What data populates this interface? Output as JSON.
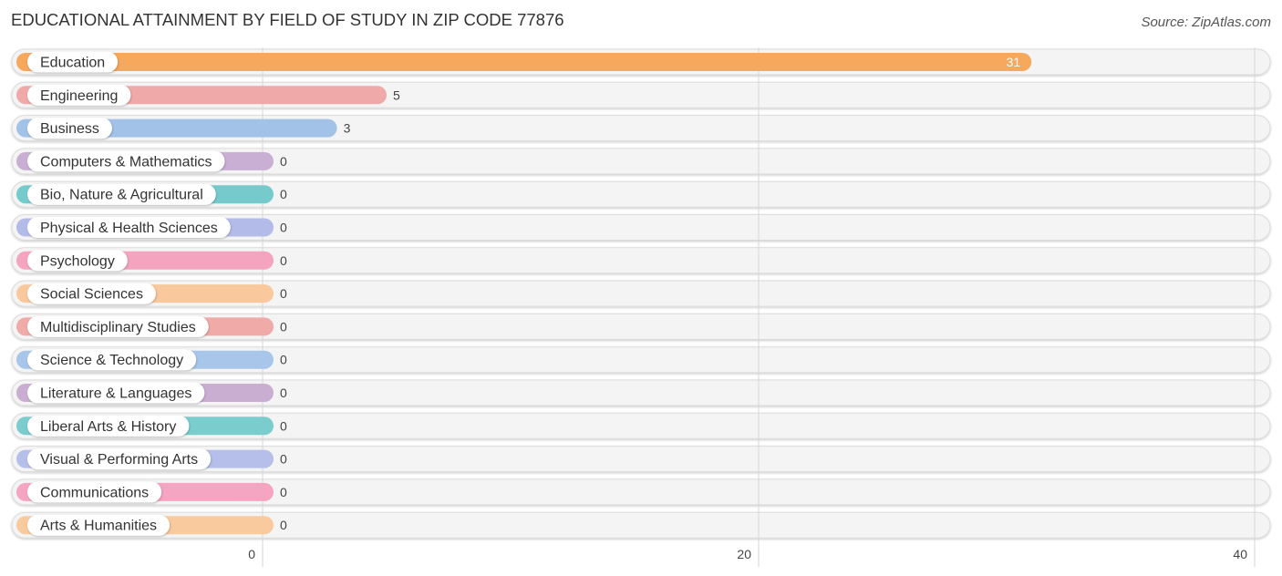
{
  "header": {
    "title": "EDUCATIONAL ATTAINMENT BY FIELD OF STUDY IN ZIP CODE 77876",
    "source": "Source: ZipAtlas.com"
  },
  "chart_data": {
    "type": "bar",
    "orientation": "horizontal",
    "title": "EDUCATIONAL ATTAINMENT BY FIELD OF STUDY IN ZIP CODE 77876",
    "xlabel": "",
    "ylabel": "",
    "xlim": [
      0,
      40
    ],
    "x_ticks": [
      0,
      20,
      40
    ],
    "x_tick_labels": [
      "0",
      "20",
      "40"
    ],
    "grid": true,
    "legend": "none",
    "categories": [
      "Education",
      "Engineering",
      "Business",
      "Computers & Mathematics",
      "Bio, Nature & Agricultural",
      "Physical & Health Sciences",
      "Psychology",
      "Social Sciences",
      "Multidisciplinary Studies",
      "Science & Technology",
      "Literature & Languages",
      "Liberal Arts & History",
      "Visual & Performing Arts",
      "Communications",
      "Arts & Humanities"
    ],
    "values": [
      31,
      5,
      3,
      0,
      0,
      0,
      0,
      0,
      0,
      0,
      0,
      0,
      0,
      0,
      0
    ],
    "value_labels": [
      "31",
      "5",
      "3",
      "0",
      "0",
      "0",
      "0",
      "0",
      "0",
      "0",
      "0",
      "0",
      "0",
      "0",
      "0"
    ],
    "colors": [
      "#f6a85c",
      "#eea9a8",
      "#a2c2e8",
      "#c9afd3",
      "#76cacc",
      "#b3bce9",
      "#f5a4c0",
      "#f9c89c",
      "#f0aaa8",
      "#a7c6ea",
      "#c9aed2",
      "#7acccd",
      "#b6bfea",
      "#f5a5c1",
      "#f8ca9d"
    ]
  }
}
